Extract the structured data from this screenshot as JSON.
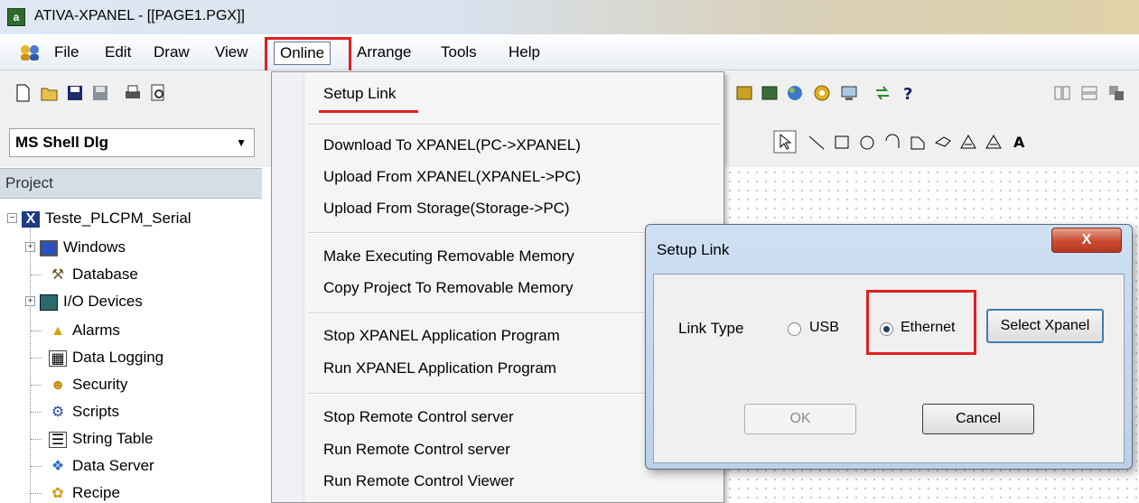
{
  "window": {
    "title": "ATIVA-XPANEL - [[PAGE1.PGX]]",
    "icon_text": "a"
  },
  "menubar": {
    "items": [
      "File",
      "Edit",
      "Draw",
      "View",
      "Online",
      "Arrange",
      "Tools",
      "Help"
    ]
  },
  "toolbar": {
    "font_name": "MS Shell Dlg"
  },
  "project": {
    "header": "Project",
    "root": "Teste_PLCPM_Serial",
    "items": [
      "Windows",
      "Database",
      "I/O Devices",
      "Alarms",
      "Data Logging",
      "Security",
      "Scripts",
      "String Table",
      "Data Server",
      "Recipe"
    ]
  },
  "online_menu": {
    "items": [
      "Setup Link",
      "Download To XPANEL(PC->XPANEL)",
      "Upload From XPANEL(XPANEL->PC)",
      "Upload From Storage(Storage->PC)",
      "Make Executing Removable Memory",
      "Copy Project To Removable Memory",
      "Stop XPANEL Application Program",
      "Run XPANEL Application Program",
      "Stop Remote Control server",
      "Run Remote Control server",
      "Run Remote Control Viewer"
    ]
  },
  "dialog": {
    "title": "Setup Link",
    "close_glyph": "X",
    "link_type_label": "Link Type",
    "options": [
      "USB",
      "Ethernet"
    ],
    "selected": "Ethernet",
    "select_button": "Select Xpanel",
    "ok_label": "OK",
    "cancel_label": "Cancel"
  },
  "colors": {
    "highlight": "#e02020",
    "dialog_frame": "#bcd1ea",
    "close_button": "#c94a32"
  }
}
